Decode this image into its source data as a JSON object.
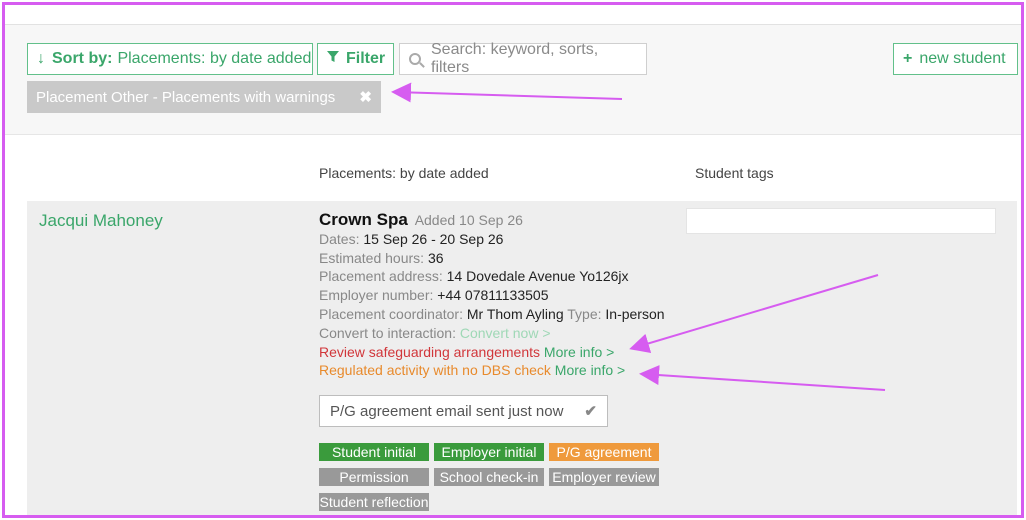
{
  "toolbar": {
    "sort_prefix": "Sort by:",
    "sort_value": "Placements: by date added",
    "filter_label": "Filter",
    "search_placeholder": "Search: keyword, sorts, filters",
    "new_student_label": "new student"
  },
  "active_filter": {
    "label": "Placement Other - Placements with warnings"
  },
  "columns": {
    "placements": "Placements: by date added",
    "tags": "Student tags"
  },
  "student": {
    "name": "Jacqui Mahoney",
    "placement": {
      "employer": "Crown Spa",
      "added": "Added 10 Sep 26",
      "dates_label": "Dates:",
      "dates_value": "15 Sep 26 - 20 Sep 26",
      "hours_label": "Estimated hours:",
      "hours_value": "36",
      "address_label": "Placement address:",
      "address_value": "14 Dovedale Avenue Yo126jx",
      "employer_number_label": "Employer number:",
      "employer_number_value": "+44 07811133505",
      "coordinator_label": "Placement coordinator:",
      "coordinator_value": "Mr Thom Ayling",
      "type_label": "Type:",
      "type_value": "In-person",
      "convert_label": "Convert to interaction:",
      "convert_link": "Convert now >",
      "warning_safeguarding": "Review safeguarding arrangements",
      "warning_dbs": "Regulated activity with no DBS check",
      "more_info": "More info >"
    },
    "status_text": "P/G agreement email sent just now",
    "badges": [
      {
        "label": "Student initial",
        "color": "#3a9b3c"
      },
      {
        "label": "Employer initial",
        "color": "#3a9b3c"
      },
      {
        "label": "P/G agreement",
        "color": "#ef9a3c"
      },
      {
        "label": "Permission",
        "color": "#999999"
      },
      {
        "label": "School check-in",
        "color": "#999999"
      },
      {
        "label": "Employer review",
        "color": "#999999"
      },
      {
        "label": "Student reflection",
        "color": "#999999"
      }
    ]
  },
  "colors": {
    "annotation": "#d65cf0",
    "accent_green": "#3aa66a",
    "warning_red": "#d1363a",
    "warning_orange": "#e88a2c"
  }
}
